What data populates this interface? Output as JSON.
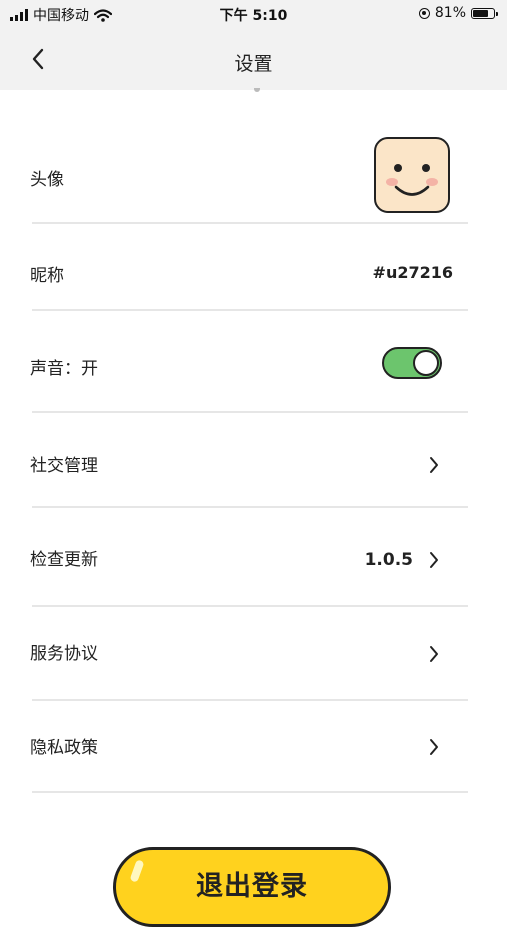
{
  "status_bar": {
    "carrier": "中国移动",
    "time": "下午 5:10",
    "battery": "81%",
    "battery_level": 0.81,
    "icons": [
      "signal-icon",
      "wifi-icon",
      "orientation-lock-icon",
      "battery-icon"
    ]
  },
  "nav": {
    "title": "设置",
    "back_icon": "chevron-left-icon"
  },
  "settings": {
    "avatar": {
      "label": "头像"
    },
    "nickname": {
      "label": "昵称",
      "value": "#u27216"
    },
    "sound": {
      "label": "声音：开",
      "enabled": true
    },
    "social": {
      "label": "社交管理"
    },
    "update": {
      "label": "检查更新",
      "value": "1.0.5"
    },
    "terms": {
      "label": "服务协议"
    },
    "privacy": {
      "label": "隐私政策"
    }
  },
  "logout_button": {
    "label": "退出登录"
  },
  "colors": {
    "toggle_on": "#6cc56d",
    "logout_button": "#ffd21e",
    "avatar_face": "#fbe5c8",
    "header_bg": "#f2f2f2"
  }
}
